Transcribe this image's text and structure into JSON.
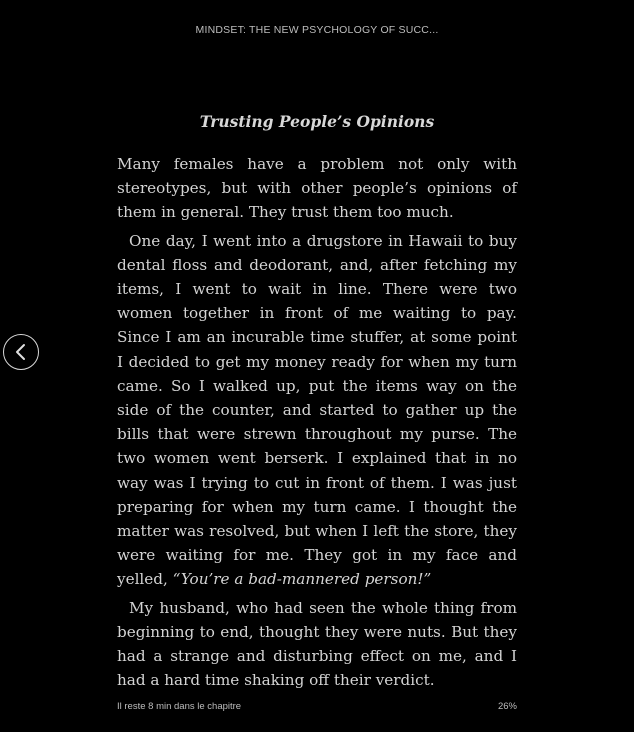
{
  "header": {
    "book_title": "MINDSET: THE NEW PSYCHOLOGY OF SUCC..."
  },
  "navigation": {
    "prev_icon": "chevron-left-icon"
  },
  "chapter": {
    "heading": "Trusting People’s Opinions",
    "paragraphs": [
      {
        "text": "Many females have a problem not only with stereotypes, but with other people’s opinions of them in general. They trust them too much."
      },
      {
        "text": "One day, I went into a drugstore in Hawaii to buy dental floss and deodorant, and, after fetching my items, I went to wait in line. There were two women together in front of me waiting to pay. Since I am an incurable time stuffer, at some point I decided to get my money ready for when my turn came. So I walked up, put the items way on the side of the counter, and started to gather up the bills that were strewn throughout my purse. The two women went berserk. I explained that in no way was I trying to cut in front of them. I was just preparing for when my turn came. I thought the matter was resolved, but when I left the store, they were waiting for me. They got in my face and yelled, ",
        "quote": "“You’re a bad-mannered person!”"
      },
      {
        "text": "My husband, who had seen the whole thing from beginning to end, thought they were nuts. But they had a strange and disturbing effect on me, and I had a hard time shaking off their verdict."
      }
    ]
  },
  "footer": {
    "time_left": "Il reste 8 min dans le chapitre",
    "progress_percent": "26%"
  },
  "colors": {
    "background": "#000000",
    "text": "#d4d4d4",
    "muted_text": "#bdbdbd"
  }
}
